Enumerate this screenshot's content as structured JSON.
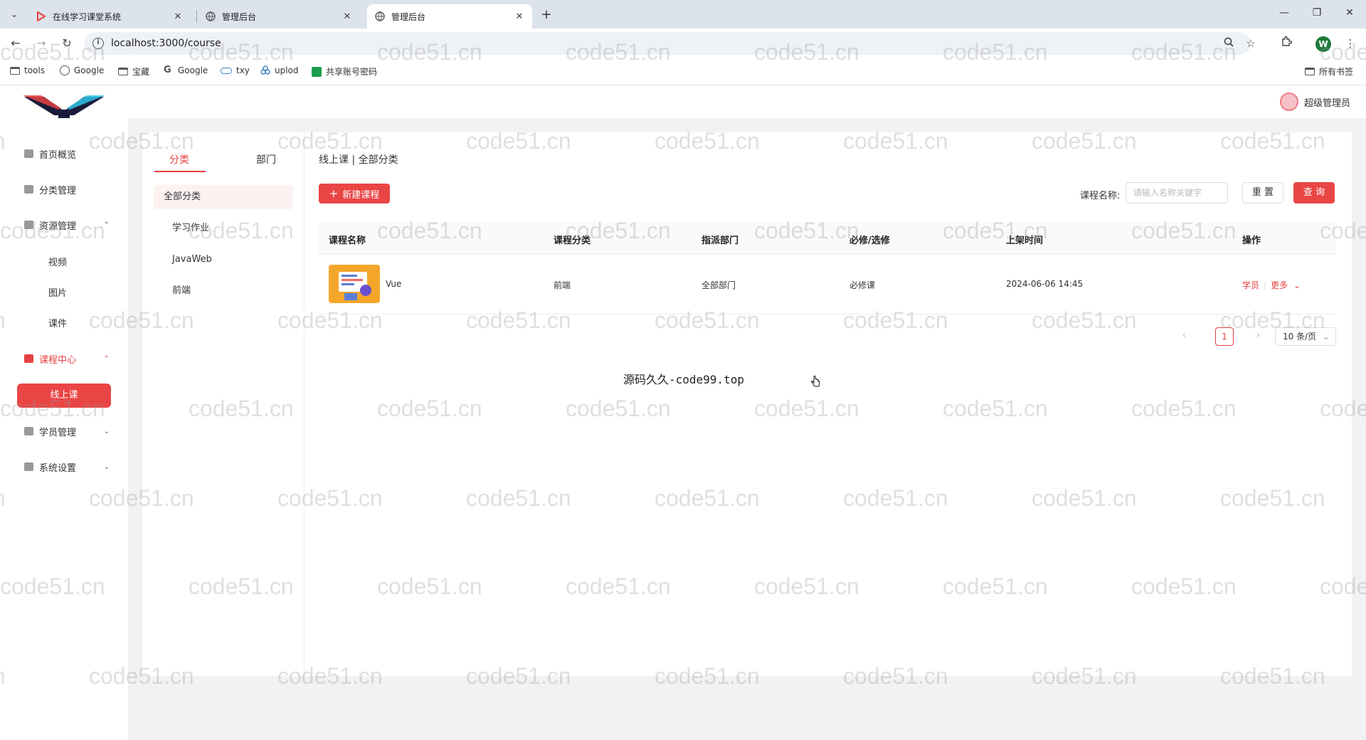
{
  "browser": {
    "tabs": [
      {
        "title": "在线学习课堂系统",
        "active": false
      },
      {
        "title": "管理后台",
        "active": false
      },
      {
        "title": "管理后台",
        "active": true
      }
    ],
    "new_tab": "+",
    "url": "localhost:3000/course",
    "profile_initial": "W",
    "bookmarks": [
      {
        "label": "tools",
        "icon": "folder-icon"
      },
      {
        "label": "Google",
        "icon": "globe-icon"
      },
      {
        "label": "宝藏",
        "icon": "folder-icon"
      },
      {
        "label": "Google",
        "icon": "google-icon"
      },
      {
        "label": "txy",
        "icon": "cloud-icon"
      },
      {
        "label": "uplod",
        "icon": "upload-icon"
      },
      {
        "label": "共享账号密码",
        "icon": "sheet-icon"
      }
    ],
    "all_bookmarks": "所有书签"
  },
  "header": {
    "user": "超级管理员"
  },
  "sidebar": {
    "items": [
      {
        "label": "首页概览"
      },
      {
        "label": "分类管理"
      },
      {
        "label": "资源管理"
      },
      {
        "label": "视频"
      },
      {
        "label": "图片"
      },
      {
        "label": "课件"
      },
      {
        "label": "课程中心"
      },
      {
        "label": "线上课"
      },
      {
        "label": "学员管理"
      },
      {
        "label": "系统设置"
      }
    ]
  },
  "left_panel": {
    "tabs": [
      "分类",
      "部门"
    ],
    "items": [
      "全部分类",
      "学习作业",
      "JavaWeb",
      "前端"
    ]
  },
  "main": {
    "breadcrumb": "线上课 | 全部分类",
    "new_button": "新建课程",
    "search_label": "课程名称:",
    "search_placeholder": "请输入名称关键字",
    "reset_button": "重 置",
    "query_button": "查 询",
    "columns": [
      "课程名称",
      "课程分类",
      "指派部门",
      "必修/选修",
      "上架时间",
      "操作"
    ],
    "rows": [
      {
        "name": "Vue",
        "category": "前端",
        "department": "全部部门",
        "type": "必修课",
        "time": "2024-06-06 14:45",
        "op_students": "学员",
        "op_more": "更多"
      }
    ],
    "pager": {
      "current": "1",
      "page_size": "10 条/页"
    }
  },
  "footer_text": "源码久久-code99.top",
  "watermark": "code51.cn",
  "colors": {
    "accent": "#ea4545",
    "accent_text": "#e64141"
  }
}
